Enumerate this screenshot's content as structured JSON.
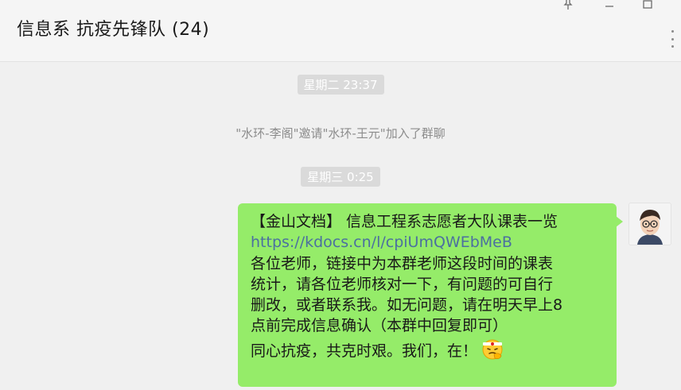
{
  "header": {
    "title": "信息系 抗疫先锋队 (24)",
    "window_controls": [
      "pin-icon",
      "minimize-icon",
      "maximize-icon"
    ],
    "more_icon": "more-vertical-icon"
  },
  "chat": {
    "timestamp_1": "星期二 23:37",
    "system_message": "\"水环-李阁\"邀请\"水环-王元\"加入了群聊",
    "timestamp_2": "星期三 0:25",
    "message": {
      "line1": "【金山文档】 信息工程系志愿者大队课表一览",
      "link": "https://kdocs.cn/l/cpiUmQWEbMeB",
      "line3": "各位老师，链接中为本群老师这段时间的课表",
      "line4": "统计，请各位老师核对一下，有问题的可自行",
      "line5": "删改，或者联系我。如无问题，请在明天早上8",
      "line6": "点前完成信息确认（本群中回复即可）",
      "line7": "同心抗疫，共克时艰。我们，在！",
      "emoji": "fighting-emoji",
      "bubble_color": "#95ec69",
      "link_color": "#4b6fa0"
    },
    "sender_avatar": "avatar-cartoon-man-with-glasses"
  }
}
